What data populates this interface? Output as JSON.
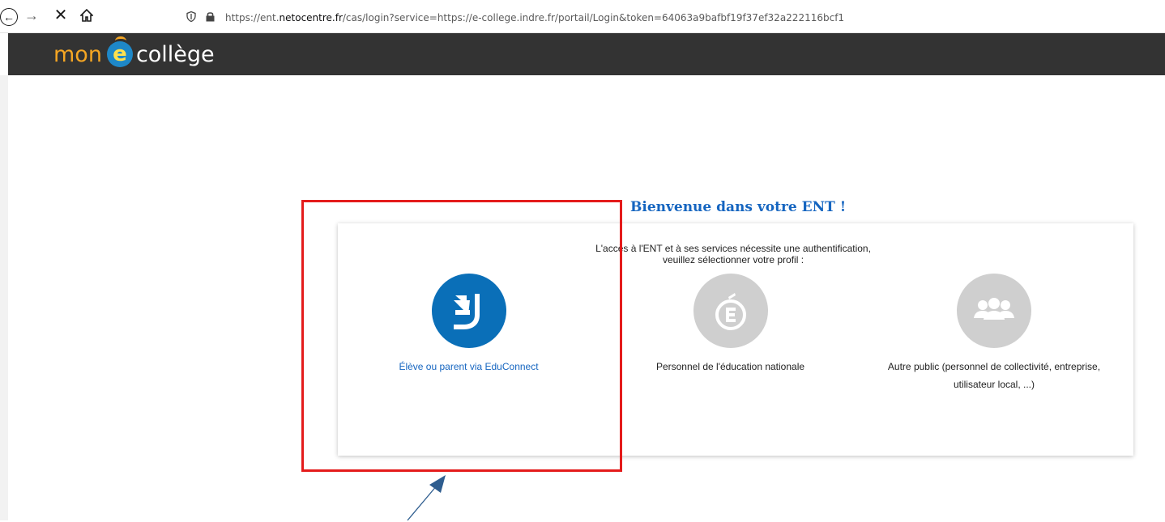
{
  "browser": {
    "url_prefix": "https://ent.",
    "url_domain": "netocentre.fr",
    "url_suffix": "/cas/login?service=https://e-college.indre.fr/portail/Login&token=64063a9bafbf19f37ef32a222116bcf1",
    "icons": [
      "back-icon",
      "forward-icon",
      "stop-icon",
      "home-icon",
      "shield-icon",
      "lock-icon"
    ]
  },
  "header": {
    "logo_mon": "mon",
    "logo_e": "e",
    "logo_college": "collège"
  },
  "main": {
    "welcome_title": "Bienvenue dans votre ENT !",
    "intro_line1": "L'accès à l'ENT et à ses services nécessite une authentification,",
    "intro_line2": "veuillez sélectionner votre profil :",
    "profiles": [
      {
        "label": "Élève ou parent via EduConnect",
        "icon": "educonnect-icon"
      },
      {
        "label": "Personnel de l'éducation nationale",
        "icon": "education-nationale-icon"
      },
      {
        "label_line1": "Autre public (personnel de collectivité, entreprise,",
        "label_line2": "utilisateur local, ...)",
        "icon": "group-icon"
      }
    ]
  },
  "colors": {
    "header_bg": "#333333",
    "title_blue": "#1565c0",
    "educonnect_blue": "#0a6fb8",
    "gray_circle": "#cfcfcf",
    "highlight_red": "#e41b1b",
    "arrow_blue": "#2e5d8f"
  }
}
